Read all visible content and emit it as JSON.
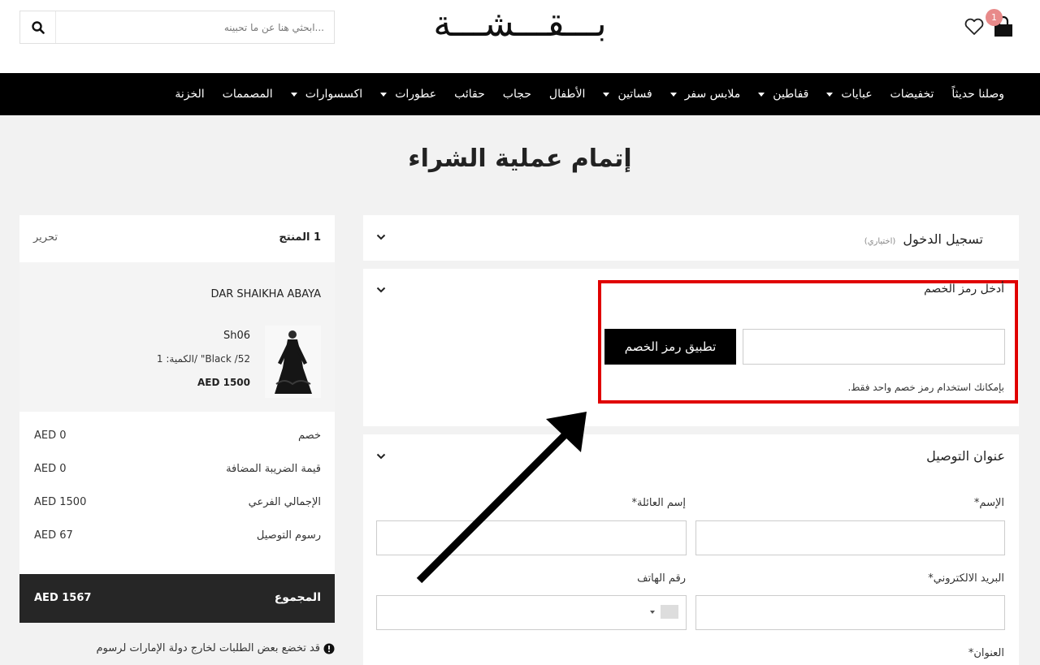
{
  "header": {
    "search_placeholder": "...ابحثي هنا عن ما تحبينه",
    "logo_text": "بـــقـــشـــة",
    "cart_count": "1"
  },
  "nav": {
    "items": [
      {
        "label": "وصلنا حديثاً",
        "dropdown": false
      },
      {
        "label": "تخفيضات",
        "dropdown": false
      },
      {
        "label": "عبايات",
        "dropdown": true
      },
      {
        "label": "قفاطين",
        "dropdown": true
      },
      {
        "label": "ملابس سفر",
        "dropdown": true
      },
      {
        "label": "فساتين",
        "dropdown": true
      },
      {
        "label": "الأطفال",
        "dropdown": false
      },
      {
        "label": "حجاب",
        "dropdown": false
      },
      {
        "label": "حقائب",
        "dropdown": false
      },
      {
        "label": "عطورات",
        "dropdown": true
      },
      {
        "label": "اكسسوارات",
        "dropdown": true
      },
      {
        "label": "المصممات",
        "dropdown": false
      },
      {
        "label": "الخزنة",
        "dropdown": false
      }
    ]
  },
  "page": {
    "title": "إتمام عملية الشراء"
  },
  "login": {
    "title": "تسجيل الدخول",
    "optional": "(اختياري)"
  },
  "coupon": {
    "label": "أدخل رمز الخصم",
    "button": "تطبيق رمز الخصم",
    "note": "بإمكانك استخدام رمز خصم واحد فقط."
  },
  "shipping": {
    "title": "عنوان التوصيل",
    "first_name_label": "الإسم*",
    "last_name_label": "إسم العائلة*",
    "email_label": "البريد الالكتروني*",
    "phone_label": "رقم الهاتف",
    "address_label": "العنوان*"
  },
  "summary": {
    "count_label": "1 المنتج",
    "edit_label": "تحرير",
    "product": {
      "brand": "DAR SHAIKHA ABAYA",
      "sku": "Sh06",
      "variant": "52/ Black\" /الكمية: 1",
      "price": "AED 1500"
    },
    "rows": [
      {
        "label": "خصم",
        "value": "AED 0"
      },
      {
        "label": "قيمة الضريبة المضافة",
        "value": "AED 0"
      },
      {
        "label": "الإجمالي الفرعي",
        "value": "AED 1500"
      },
      {
        "label": "رسوم التوصيل",
        "value": "AED 67"
      }
    ],
    "total_label": "المجموع",
    "total_value": "AED 1567",
    "notice": "قد تخضع بعض الطلبات لخارج دولة الإمارات لرسوم"
  },
  "colors": {
    "highlight": "#e00000",
    "nav_bg": "#000000",
    "badge": "#e88a8a",
    "total_bg": "#262626"
  }
}
